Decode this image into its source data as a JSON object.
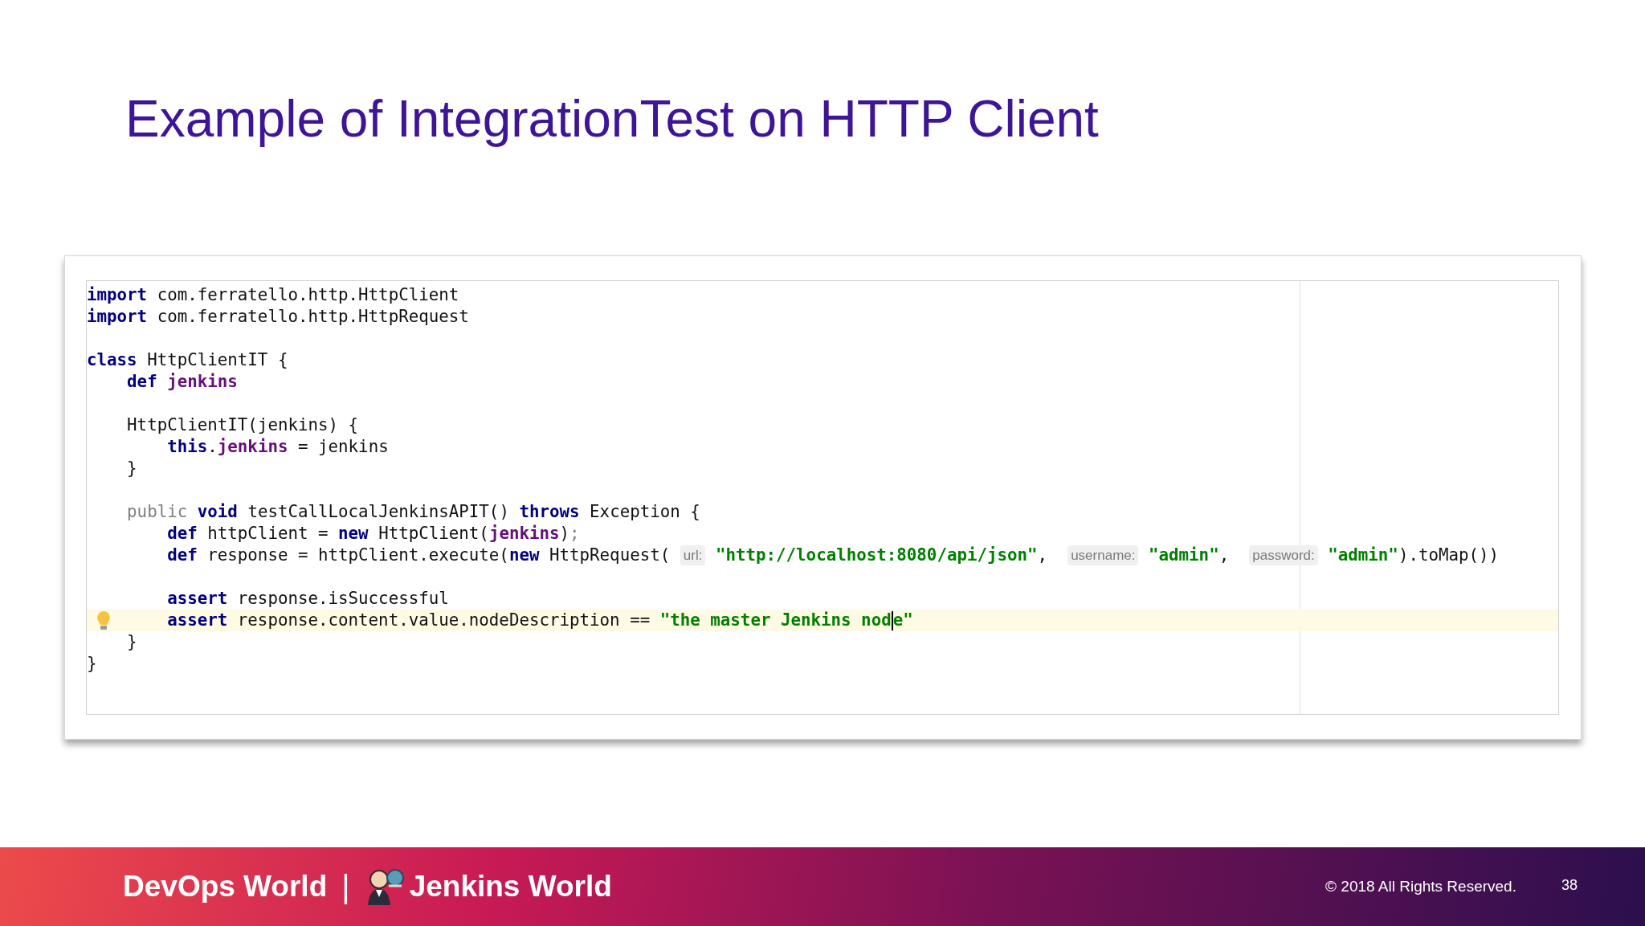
{
  "slide_title": "Example of IntegrationTest on HTTP Client",
  "code": {
    "lines": [
      {
        "highlighted": false,
        "bulb": false,
        "tokens": [
          {
            "kind": "keyword",
            "text": "import"
          },
          {
            "kind": "plain",
            "text": " com.ferratello.http.HttpClient"
          }
        ]
      },
      {
        "highlighted": false,
        "bulb": false,
        "tokens": [
          {
            "kind": "keyword",
            "text": "import"
          },
          {
            "kind": "plain",
            "text": " com.ferratello.http.HttpRequest"
          }
        ]
      },
      {
        "highlighted": false,
        "bulb": false
      },
      {
        "highlighted": false,
        "bulb": false,
        "tokens": [
          {
            "kind": "keyword",
            "text": "class"
          },
          {
            "kind": "plain",
            "text": " HttpClientIT {"
          }
        ]
      },
      {
        "highlighted": false,
        "bulb": false,
        "tokens": [
          {
            "kind": "keyword",
            "text": "    def "
          },
          {
            "kind": "field",
            "text": "jenkins"
          }
        ]
      },
      {
        "highlighted": false,
        "bulb": false
      },
      {
        "highlighted": false,
        "bulb": false,
        "tokens": [
          {
            "kind": "plain",
            "text": "    HttpClientIT(jenkins) {"
          }
        ]
      },
      {
        "highlighted": false,
        "bulb": false,
        "tokens": [
          {
            "kind": "keyword",
            "text": "        this"
          },
          {
            "kind": "plain",
            "text": "."
          },
          {
            "kind": "field",
            "text": "jenkins"
          },
          {
            "kind": "plain",
            "text": " = jenkins"
          }
        ]
      },
      {
        "highlighted": false,
        "bulb": false,
        "tokens": [
          {
            "kind": "plain",
            "text": "    }"
          }
        ]
      },
      {
        "highlighted": false,
        "bulb": false
      },
      {
        "highlighted": false,
        "bulb": false,
        "tokens": [
          {
            "kind": "muted",
            "text": "    public "
          },
          {
            "kind": "keyword",
            "text": "void"
          },
          {
            "kind": "plain",
            "text": " testCallLocalJenkinsAPIT() "
          },
          {
            "kind": "keyword",
            "text": "throws"
          },
          {
            "kind": "plain",
            "text": " Exception {"
          }
        ]
      },
      {
        "highlighted": false,
        "bulb": false,
        "tokens": [
          {
            "kind": "keyword",
            "text": "        def"
          },
          {
            "kind": "plain",
            "text": " httpClient = "
          },
          {
            "kind": "keyword",
            "text": "new"
          },
          {
            "kind": "plain",
            "text": " HttpClient("
          },
          {
            "kind": "field",
            "text": "jenkins"
          },
          {
            "kind": "plain",
            "text": ")"
          },
          {
            "kind": "muted",
            "text": ";"
          }
        ]
      },
      {
        "highlighted": false,
        "bulb": false,
        "tokens": [
          {
            "kind": "keyword",
            "text": "        def"
          },
          {
            "kind": "plain",
            "text": " response = httpClient.execute("
          },
          {
            "kind": "keyword",
            "text": "new"
          },
          {
            "kind": "plain",
            "text": " HttpRequest( "
          },
          {
            "kind": "hint",
            "text": "url:"
          },
          {
            "kind": "string",
            "text": " \"http://localhost:8080/api/json\""
          },
          {
            "kind": "plain",
            "text": ",  "
          },
          {
            "kind": "hint",
            "text": "username:"
          },
          {
            "kind": "string",
            "text": " \"admin\""
          },
          {
            "kind": "plain",
            "text": ",  "
          },
          {
            "kind": "hint",
            "text": "password:"
          },
          {
            "kind": "string",
            "text": " \"admin\""
          },
          {
            "kind": "plain",
            "text": ").toMap())"
          }
        ]
      },
      {
        "highlighted": false,
        "bulb": false
      },
      {
        "highlighted": false,
        "bulb": false,
        "tokens": [
          {
            "kind": "keyword",
            "text": "        assert"
          },
          {
            "kind": "plain",
            "text": " response.isSuccessful"
          }
        ]
      },
      {
        "highlighted": true,
        "bulb": true,
        "tokens": [
          {
            "kind": "keyword",
            "text": "        assert"
          },
          {
            "kind": "plain",
            "text": " response.content.value.nodeDescription == "
          },
          {
            "kind": "string",
            "text": "\"the master Jenkins nod"
          },
          {
            "kind": "caret"
          },
          {
            "kind": "string",
            "text": "e\""
          }
        ]
      },
      {
        "highlighted": false,
        "bulb": false,
        "tokens": [
          {
            "kind": "plain",
            "text": "    }"
          }
        ]
      },
      {
        "highlighted": false,
        "bulb": false,
        "tokens": [
          {
            "kind": "plain",
            "text": "}"
          }
        ]
      }
    ]
  },
  "footer": {
    "brand_left": "DevOps World",
    "brand_separator": "|",
    "brand_right": "Jenkins World",
    "copyright": "© 2018 All Rights Reserved.",
    "page_number": "38"
  }
}
